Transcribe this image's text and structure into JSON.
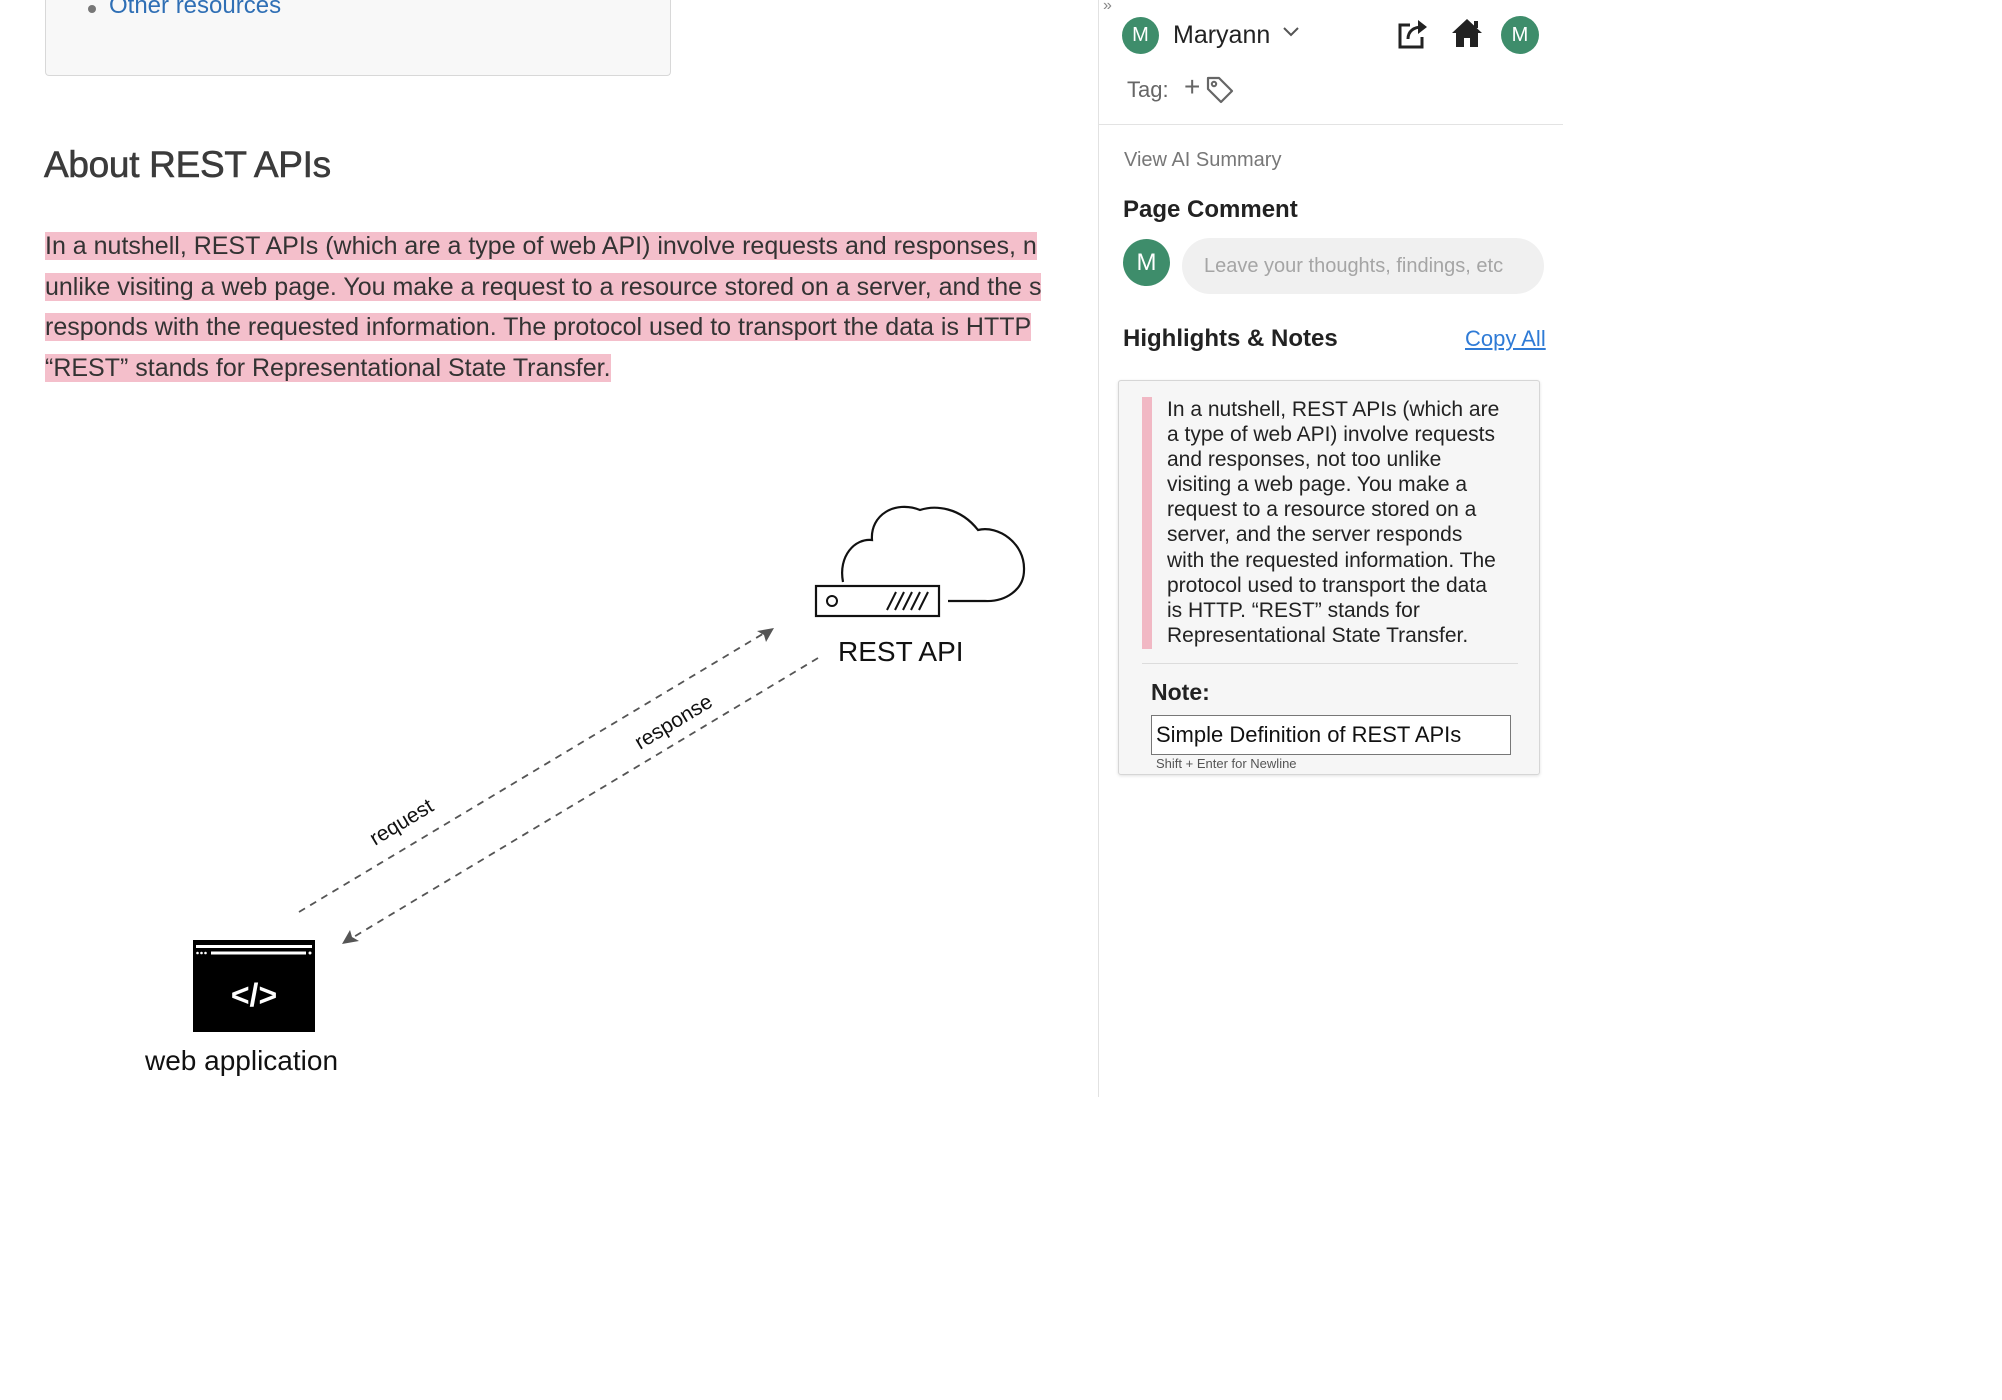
{
  "article": {
    "toc_link": "Other resources",
    "section_title": "About REST APIs",
    "paragraph_lines": [
      "In a nutshell, REST APIs (which are a type of web API) involve requests and responses, n",
      "unlike visiting a web page. You make a request to a resource stored on a server, and the s",
      "responds with the requested information. The protocol used to transport the data is HTTP",
      "“REST” stands for Representational State Transfer."
    ],
    "diagram": {
      "server_label": "REST API",
      "client_label": "web application",
      "code_glyph": "</>",
      "request_label": "request",
      "response_label": "response"
    }
  },
  "panel": {
    "user": {
      "initial": "M",
      "name": "Maryann"
    },
    "account_initial": "M",
    "tag_label": "Tag:",
    "tag_add": "+",
    "ai_summary": "View AI Summary",
    "page_comment": {
      "title": "Page Comment",
      "avatar_initial": "M",
      "placeholder": "Leave your thoughts, findings, etc"
    },
    "highlights": {
      "title": "Highlights & Notes",
      "copy_all": "Copy All",
      "quote_lines": [
        "In a nutshell, REST APIs (which are",
        "a type of web API) involve requests",
        "and responses, not too unlike",
        "visiting a web page. You make a",
        "request to a resource stored on a",
        "server, and the server responds",
        "with the requested information. The",
        "protocol used to transport the data",
        "is HTTP. “REST” stands for",
        "Representational State Transfer."
      ],
      "note_label": "Note:",
      "note_value": "Simple Definition of REST APIs",
      "note_hint": "Shift + Enter for Newline"
    }
  },
  "colors": {
    "highlight": "#f4bfcb",
    "avatar": "#3e8d6b",
    "link": "#2f6fb5"
  }
}
